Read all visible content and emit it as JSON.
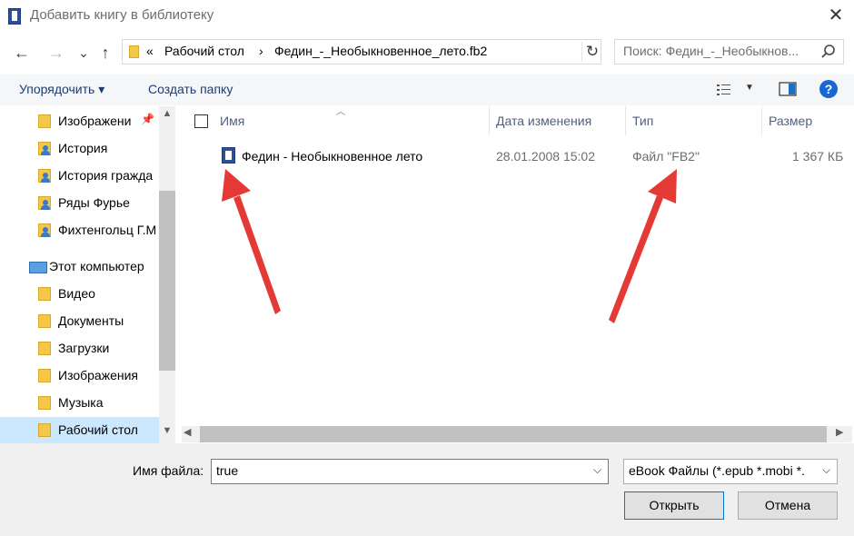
{
  "window": {
    "title": "Добавить книгу в библиотеку",
    "close_glyph": "✕"
  },
  "navigation": {
    "back_glyph": "←",
    "forward_glyph": "→",
    "recent_glyph": "⌄",
    "up_glyph": "↑"
  },
  "address": {
    "overflow_glyph": "«",
    "crumbs": [
      "Рабочий стол",
      "Федин_-_Необыкновенное_лето.fb2"
    ],
    "separator": "›",
    "refresh_glyph": "↻"
  },
  "search": {
    "placeholder": "Поиск: Федин_-_Необыкнов..."
  },
  "toolbar": {
    "organize_label": "Упорядочить ▾",
    "new_folder_label": "Создать папку",
    "help_glyph": "?"
  },
  "nav_pane": {
    "items": [
      {
        "label": "Изображени",
        "icon": "pictures-folder-icon"
      },
      {
        "label": "История",
        "icon": "user-folder-icon"
      },
      {
        "label": "История гражда",
        "icon": "user-folder-icon"
      },
      {
        "label": "Ряды Фурье",
        "icon": "user-folder-icon"
      },
      {
        "label": "Фихтенгольц Г.М",
        "icon": "user-folder-icon"
      },
      {
        "label": "Этот компьютер",
        "icon": "computer-icon"
      },
      {
        "label": "Видео",
        "icon": "video-folder-icon"
      },
      {
        "label": "Документы",
        "icon": "documents-folder-icon"
      },
      {
        "label": "Загрузки",
        "icon": "downloads-folder-icon"
      },
      {
        "label": "Изображения",
        "icon": "pictures-folder-icon"
      },
      {
        "label": "Музыка",
        "icon": "music-folder-icon"
      },
      {
        "label": "Рабочий стол",
        "icon": "desktop-folder-icon"
      }
    ],
    "selected": "Рабочий стол"
  },
  "file_list": {
    "columns": [
      "Имя",
      "Дата изменения",
      "Тип",
      "Размер"
    ],
    "rows": [
      {
        "name": "Федин - Необыкновенное лето",
        "modified": "28.01.2008 15:02",
        "type": "Файл \"FB2\"",
        "size": "1 367 КБ"
      }
    ]
  },
  "footer": {
    "filename_label": "Имя файла:",
    "filename_value": "true",
    "filter_value": "eBook Файлы (*.epub *.mobi *.",
    "open_label": "Открыть",
    "cancel_label": "Отмена"
  },
  "colors": {
    "accent": "#0078d7",
    "selection": "#cce8ff",
    "annotation_arrow": "#e53935"
  }
}
